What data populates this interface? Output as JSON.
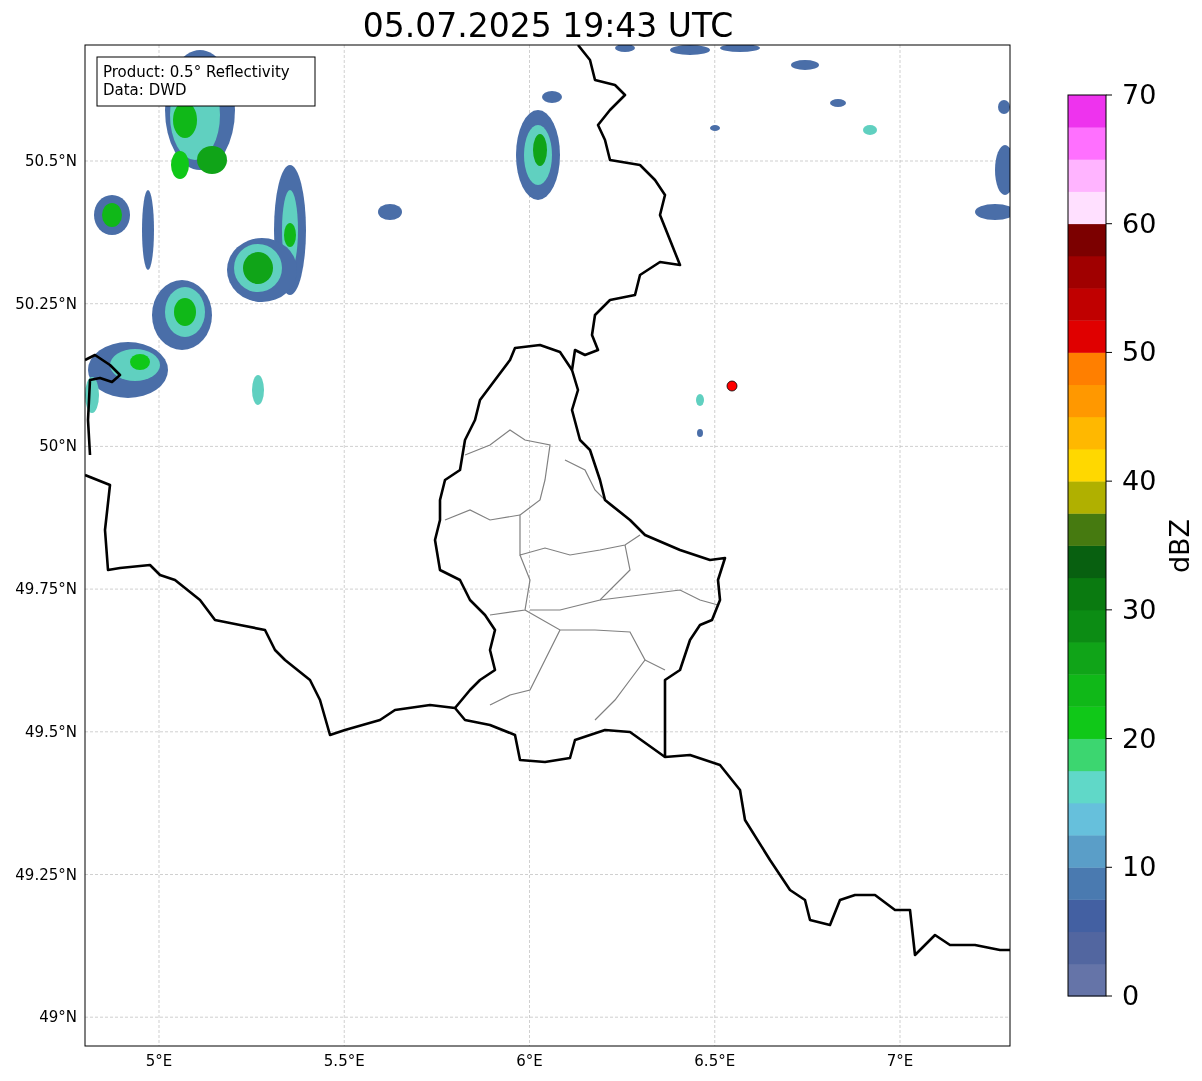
{
  "title": "05.07.2025 19:43 UTC",
  "legend": [
    "Product: 0.5° Reflectivity",
    "Data: DWD"
  ],
  "map": {
    "latitude_labels": [
      "50.5°N",
      "50.25°N",
      "50°N",
      "49.75°N",
      "49.5°N",
      "49.25°N",
      "49°N"
    ],
    "longitude_labels": [
      "5°E",
      "5.5°E",
      "6°E",
      "6.5°E",
      "7°E"
    ]
  },
  "colorbar": {
    "label": "dBZ",
    "ticks": [
      "70",
      "60",
      "50",
      "40",
      "30",
      "20",
      "10",
      "0"
    ],
    "segments": [
      {
        "color": "#6574a8"
      },
      {
        "color": "#5266a0"
      },
      {
        "color": "#4360a2"
      },
      {
        "color": "#4a7ab0"
      },
      {
        "color": "#5a9ec8"
      },
      {
        "color": "#66c0dc"
      },
      {
        "color": "#60d8c8"
      },
      {
        "color": "#3cd670"
      },
      {
        "color": "#10c818"
      },
      {
        "color": "#10b818"
      },
      {
        "color": "#10a418"
      },
      {
        "color": "#0c8c14"
      },
      {
        "color": "#0a7a10"
      },
      {
        "color": "#086010"
      },
      {
        "color": "#467a10"
      },
      {
        "color": "#b0b000"
      },
      {
        "color": "#ffd800"
      },
      {
        "color": "#ffb800"
      },
      {
        "color": "#ff9800"
      },
      {
        "color": "#ff7f00"
      },
      {
        "color": "#e00000"
      },
      {
        "color": "#c00000"
      },
      {
        "color": "#a00000"
      },
      {
        "color": "#7c0000"
      },
      {
        "color": "#ffe0ff"
      },
      {
        "color": "#ffb4ff"
      },
      {
        "color": "#ff70ff"
      },
      {
        "color": "#ee33ee"
      }
    ]
  }
}
